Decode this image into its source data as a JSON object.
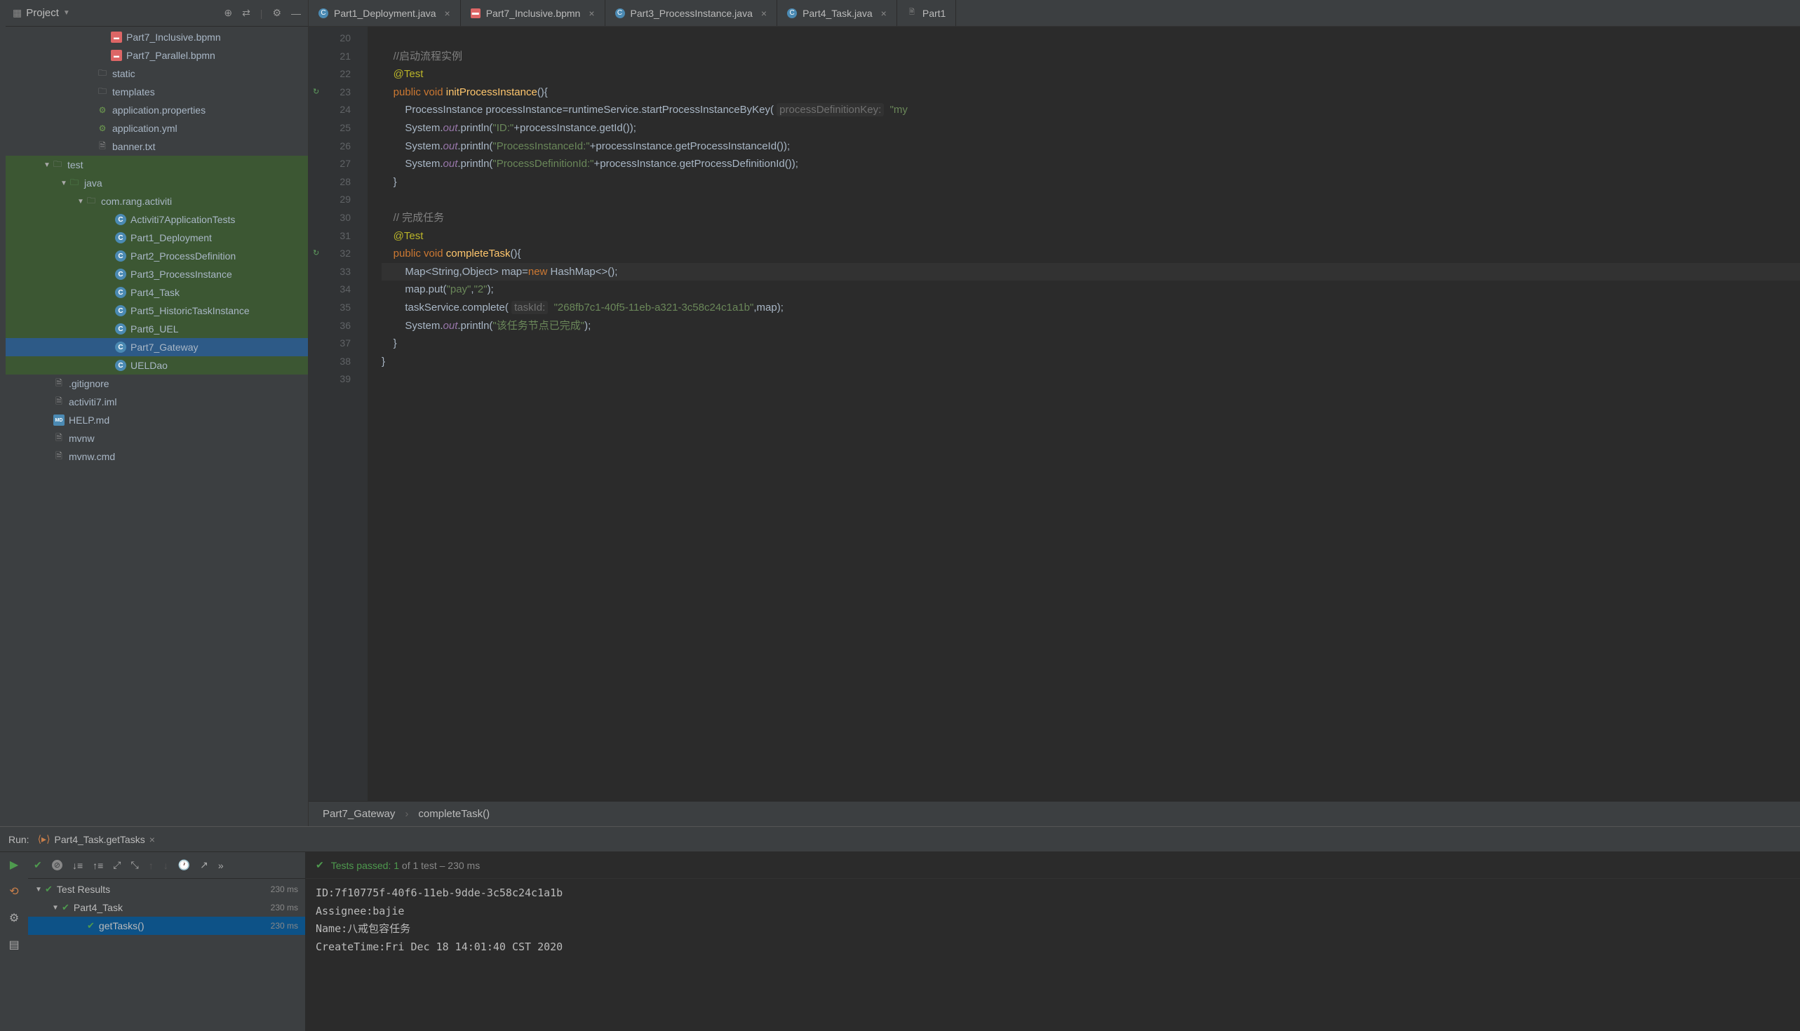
{
  "project_header": {
    "title": "Project"
  },
  "tree": [
    {
      "indent": 136,
      "icon": "bpmn",
      "label": "Part7_Inclusive.bpmn"
    },
    {
      "indent": 136,
      "icon": "bpmn",
      "label": "Part7_Parallel.bpmn"
    },
    {
      "indent": 116,
      "icon": "folder",
      "label": "static"
    },
    {
      "indent": 116,
      "icon": "folder",
      "label": "templates"
    },
    {
      "indent": 116,
      "icon": "props",
      "label": "application.properties"
    },
    {
      "indent": 116,
      "icon": "props",
      "label": "application.yml"
    },
    {
      "indent": 116,
      "icon": "file",
      "label": "banner.txt"
    },
    {
      "indent": 52,
      "arrow": "▼",
      "icon": "folder",
      "label": "test",
      "green": true
    },
    {
      "indent": 76,
      "arrow": "▼",
      "icon": "folder-src",
      "label": "java",
      "green": true
    },
    {
      "indent": 100,
      "arrow": "▼",
      "icon": "folder-pkg",
      "label": "com.rang.activiti",
      "green": true
    },
    {
      "indent": 142,
      "icon": "java",
      "label": "Activiti7ApplicationTests",
      "green": true
    },
    {
      "indent": 142,
      "icon": "java",
      "label": "Part1_Deployment",
      "green": true
    },
    {
      "indent": 142,
      "icon": "java",
      "label": "Part2_ProcessDefinition",
      "green": true
    },
    {
      "indent": 142,
      "icon": "java",
      "label": "Part3_ProcessInstance",
      "green": true
    },
    {
      "indent": 142,
      "icon": "java",
      "label": "Part4_Task",
      "green": true
    },
    {
      "indent": 142,
      "icon": "java",
      "label": "Part5_HistoricTaskInstance",
      "green": true
    },
    {
      "indent": 142,
      "icon": "java",
      "label": "Part6_UEL",
      "green": true
    },
    {
      "indent": 142,
      "icon": "java",
      "label": "Part7_Gateway",
      "green": true,
      "selected": true
    },
    {
      "indent": 142,
      "icon": "java",
      "label": "UELDao",
      "green": true
    },
    {
      "indent": 54,
      "icon": "file",
      "label": ".gitignore"
    },
    {
      "indent": 54,
      "icon": "file",
      "label": "activiti7.iml"
    },
    {
      "indent": 54,
      "icon": "md",
      "label": "HELP.md"
    },
    {
      "indent": 54,
      "icon": "file",
      "label": "mvnw"
    },
    {
      "indent": 54,
      "icon": "file",
      "label": "mvnw.cmd"
    }
  ],
  "tabs": [
    {
      "icon": "java",
      "label": "Part1_Deployment.java"
    },
    {
      "icon": "bpmn",
      "label": "Part7_Inclusive.bpmn"
    },
    {
      "icon": "java",
      "label": "Part3_ProcessInstance.java"
    },
    {
      "icon": "java",
      "label": "Part4_Task.java"
    },
    {
      "icon": "file",
      "label": "Part1",
      "partial": true
    }
  ],
  "gutter_start": 20,
  "gutter_end": 39,
  "gutter_marks": {
    "23": "↻",
    "32": "↻"
  },
  "breadcrumb": [
    "Part7_Gateway",
    "completeTask()"
  ],
  "run": {
    "label": "Run:",
    "tab": "Part4_Task.getTasks",
    "tests_passed": "Tests passed: 1",
    "tests_info": " of 1 test – 230 ms"
  },
  "test_tree": [
    {
      "indent": 0,
      "arrow": "▼",
      "label": "Test Results",
      "time": "230 ms"
    },
    {
      "indent": 24,
      "arrow": "▼",
      "label": "Part4_Task",
      "time": "230 ms"
    },
    {
      "indent": 60,
      "label": "getTasks()",
      "time": "230 ms",
      "selected": true
    }
  ],
  "console": [
    "ID:7f10775f-40f6-11eb-9dde-3c58c24c1a1b",
    "Assignee:bajie",
    "Name:八戒包容任务",
    "CreateTime:Fri Dec 18 14:01:40 CST 2020"
  ],
  "code_strings": {
    "c1": "//启动流程实例",
    "c2": "// 完成任务",
    "s_id": "\"ID:\"",
    "s_pii": "\"ProcessInstanceId:\"",
    "s_pdi": "\"ProcessDefinitionId:\"",
    "s_pay": "\"pay\"",
    "s_2": "\"2\"",
    "s_taskid": "\"268fb7c1-40f5-11eb-a321-3c58c24c1a1b\"",
    "s_done": "\"该任务节点已完成\"",
    "h_pdk": "processDefinitionKey:",
    "h_my": "\"my",
    "h_tid": "taskId:"
  }
}
